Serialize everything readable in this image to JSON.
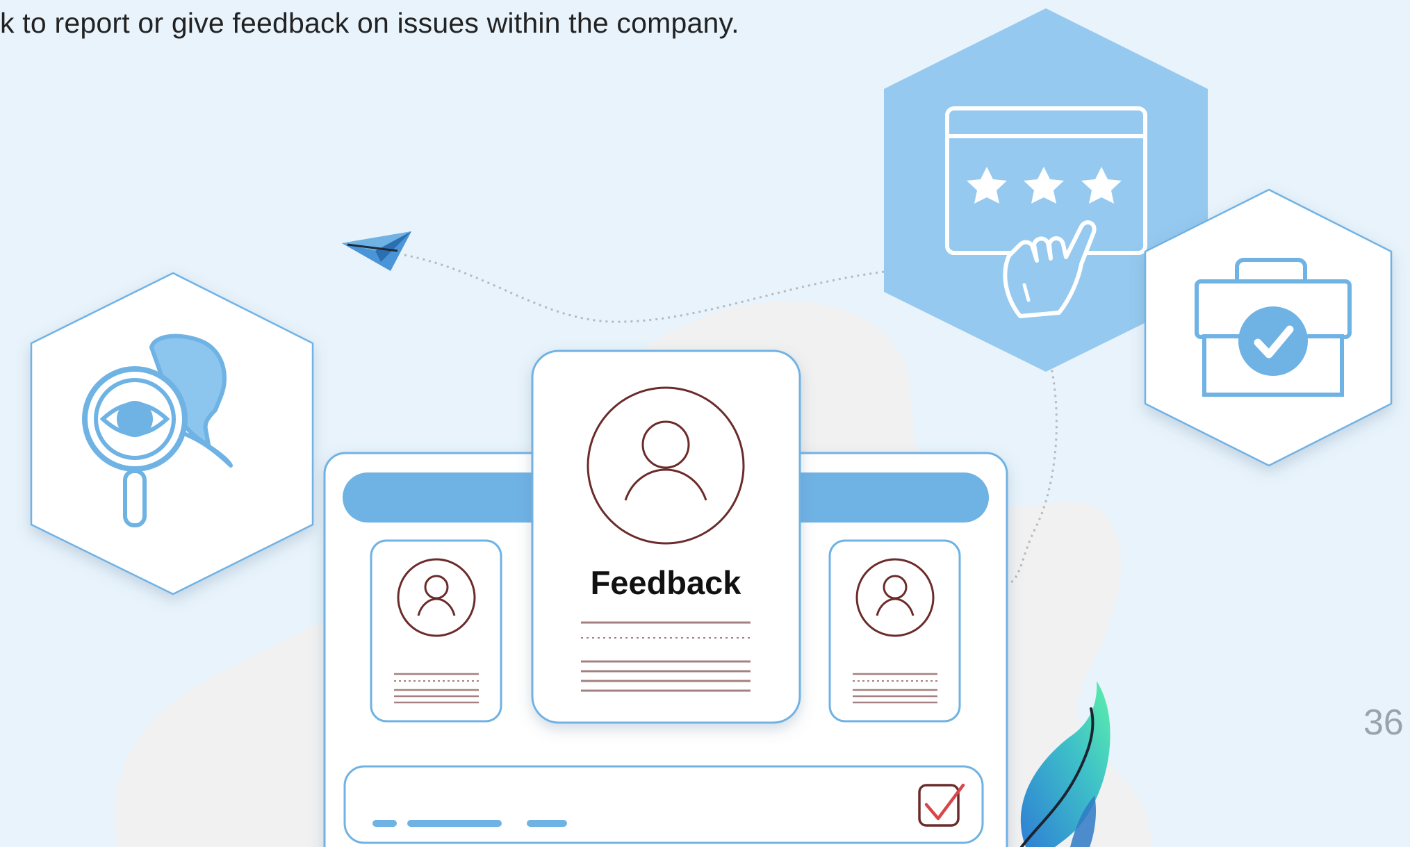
{
  "caption": {
    "text": "k to report or give feedback on issues within the company."
  },
  "page_number": "36",
  "card": {
    "title": "Feedback",
    "checkbox_state": "checked"
  },
  "rating_window": {
    "stars": 3
  },
  "icons": {
    "search": "eye-magnifier-person-icon",
    "rating": "star-rating-window-icon",
    "pointer": "pointing-hand-icon",
    "briefcase": "briefcase-check-icon",
    "send": "paper-plane-icon",
    "pen": "feather-pen-icon"
  },
  "colors": {
    "background": "#e8f3fb",
    "blob": "#f1f1f1",
    "accent_blue": "#6fb2e4",
    "light_blue": "#95c9ef",
    "outline_blue": "#7fb9e5",
    "avatar_brown": "#6b2b2b",
    "check_red": "#d9464a",
    "feather_green": "#42e3a5",
    "text_dark": "#222222",
    "text_muted": "#9aa3ab"
  }
}
